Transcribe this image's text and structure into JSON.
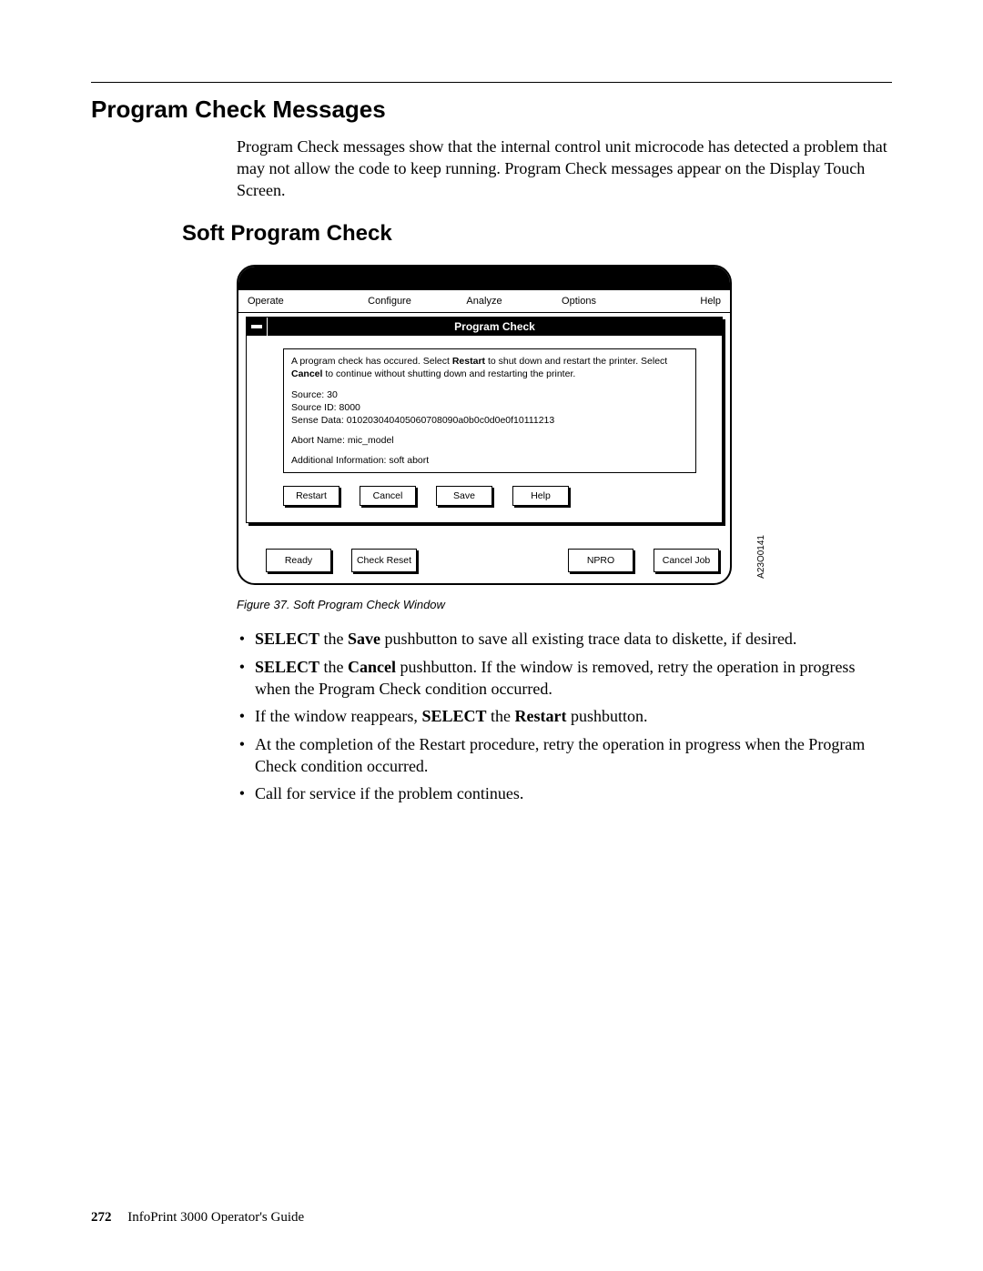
{
  "section_title": "Program Check Messages",
  "intro_text": "Program Check messages show that the internal control unit microcode has detected a problem that may not allow the code to keep running. Program Check messages appear on the Display Touch Screen.",
  "subsection_title": "Soft Program Check",
  "figure": {
    "menubar": {
      "operate": "Operate",
      "configure": "Configure",
      "analyze": "Analyze",
      "options": "Options",
      "help": "Help"
    },
    "window_title": "Program Check",
    "msg_part1": "A program check has occured. Select ",
    "msg_bold1": "Restart",
    "msg_part2": " to shut down and restart the printer.  Select ",
    "msg_bold2": "Cancel",
    "msg_part3": " to continue without shutting down and restarting the printer.",
    "source_line": "Source: 30",
    "source_id_line": "Source ID: 8000",
    "sense_line": "Sense Data: 010203040405060708090a0b0c0d0e0f10111213",
    "abort_line": "Abort Name: mic_model",
    "addl_line": "Additional Information: soft abort",
    "btn_restart": "Restart",
    "btn_cancel": "Cancel",
    "btn_save": "Save",
    "btn_help": "Help",
    "btn_ready": "Ready",
    "btn_check_reset": "Check Reset",
    "btn_npro": "NPRO",
    "btn_cancel_job": "Cancel Job",
    "fig_code": "A23O0141"
  },
  "caption": "Figure 37. Soft Program Check Window",
  "bullets": {
    "b1a": "SELECT",
    "b1b": " the ",
    "b1c": "Save",
    "b1d": " pushbutton to save all existing trace data to diskette, if desired.",
    "b2a": "SELECT",
    "b2b": " the ",
    "b2c": "Cancel",
    "b2d": " pushbutton. If the window is removed, retry the operation in progress when the Program Check condition occurred.",
    "b3a": "If the window reappears, ",
    "b3b": "SELECT",
    "b3c": " the ",
    "b3d": "Restart",
    "b3e": " pushbutton.",
    "b4": "At the completion of the Restart procedure, retry the operation in progress when the Program Check condition occurred.",
    "b5": "Call for service if the problem continues."
  },
  "footer": {
    "page_num": "272",
    "book_title": "InfoPrint 3000 Operator's Guide"
  }
}
